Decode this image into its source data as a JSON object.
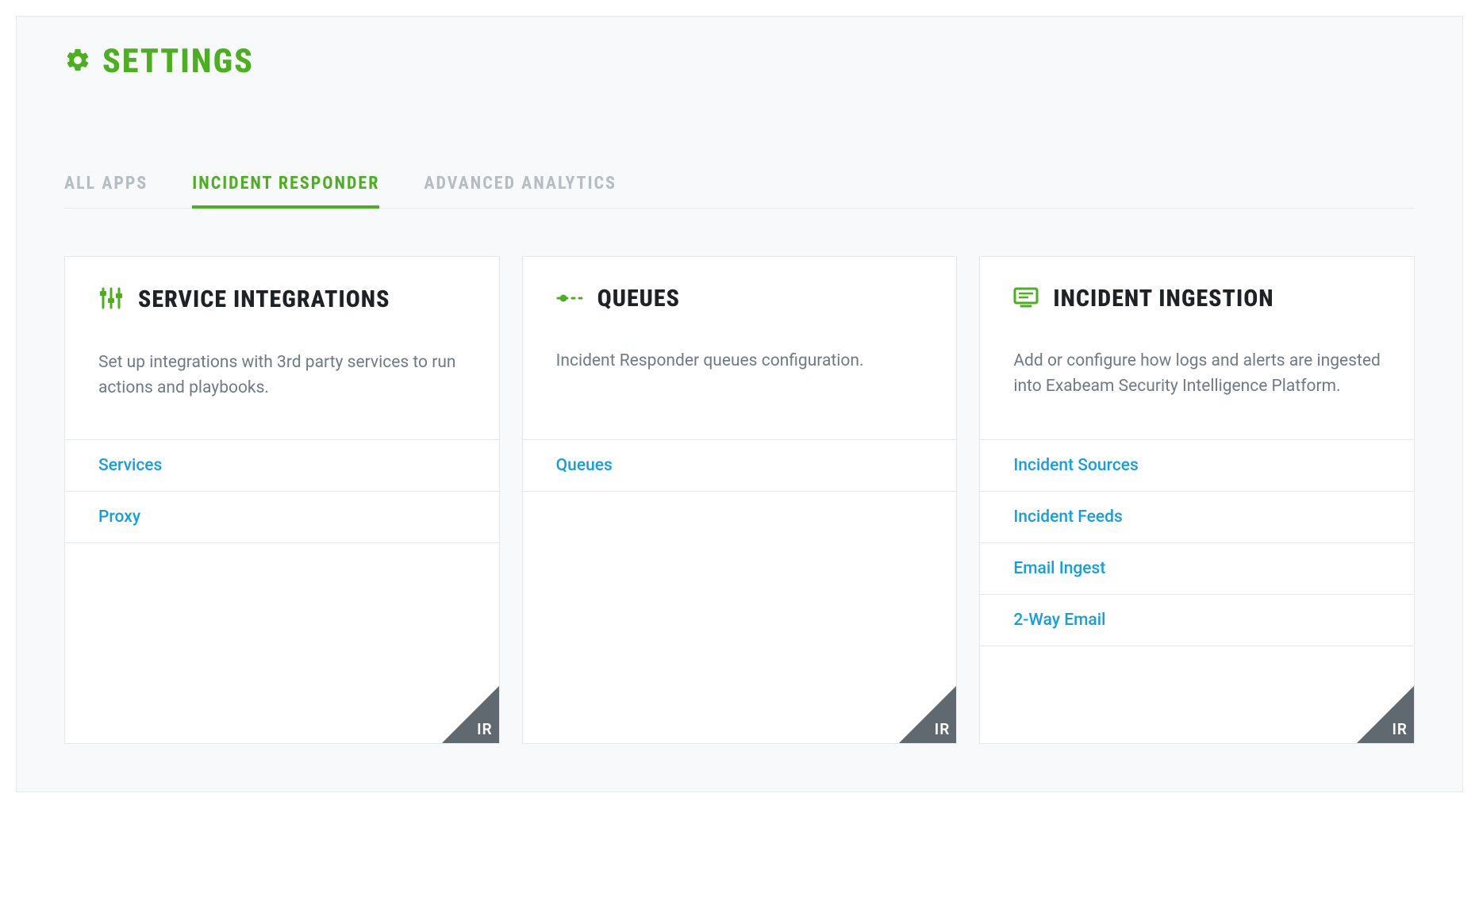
{
  "header": {
    "title": "Settings"
  },
  "tabs": [
    {
      "label": "All Apps",
      "active": false
    },
    {
      "label": "Incident Responder",
      "active": true
    },
    {
      "label": "Advanced Analytics",
      "active": false
    }
  ],
  "cards": [
    {
      "icon": "sliders-icon",
      "title": "Service Integrations",
      "description": "Set up integrations with 3rd party services to run actions and playbooks.",
      "links": [
        "Services",
        "Proxy"
      ],
      "badge": "IR"
    },
    {
      "icon": "queue-icon",
      "title": "Queues",
      "description": "Incident Responder queues configuration.",
      "links": [
        "Queues"
      ],
      "badge": "IR"
    },
    {
      "icon": "ingestion-icon",
      "title": "Incident Ingestion",
      "description": "Add or configure how logs and alerts are ingested into Exabeam Security Intelligence Platform.",
      "links": [
        "Incident Sources",
        "Incident Feeds",
        "Email Ingest",
        "2-Way Email"
      ],
      "badge": "IR"
    }
  ]
}
